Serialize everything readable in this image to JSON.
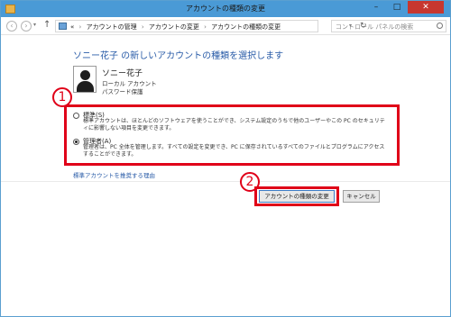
{
  "window": {
    "title": "アカウントの種類の変更",
    "controls": {
      "minimize": "–",
      "maximize": "□",
      "close": "✕"
    }
  },
  "address_bar": {
    "back_icon": "‹",
    "forward_icon": "›",
    "up_icon": "↑",
    "chevrons": "«",
    "breadcrumbs": [
      "アカウントの管理",
      "アカウントの変更",
      "アカウントの種類の変更"
    ],
    "separator": "›",
    "refresh_icon": "↻",
    "search_placeholder": "コントロール パネルの検索"
  },
  "page": {
    "heading": "ソニー花子 の新しいアカウントの種類を選択します",
    "user": {
      "name": "ソニー花子",
      "account_type": "ローカル アカウント",
      "password_status": "パスワード保護"
    },
    "options": [
      {
        "label": "標準(S)",
        "description": "標準アカウントは、ほとんどのソフトウェアを使うことができ、システム設定のうちで他のユーザーやこの PC のセキュリティに影響しない項目を変更できます。",
        "selected": false
      },
      {
        "label": "管理者(A)",
        "description": "管理者は、PC 全体を管理します。すべての設定を変更でき、PC に保存されているすべてのファイルとプログラムにアクセスすることができます。",
        "selected": true
      }
    ],
    "link": "標準アカウントを推奨する理由",
    "buttons": {
      "change": "アカウントの種類の変更",
      "cancel": "キャンセル"
    }
  },
  "annotations": {
    "callout_1": "1",
    "callout_2": "2"
  },
  "colors": {
    "highlight": "#e00018",
    "accent": "#2a5ca8",
    "titlebar": "#4a9ad6"
  }
}
